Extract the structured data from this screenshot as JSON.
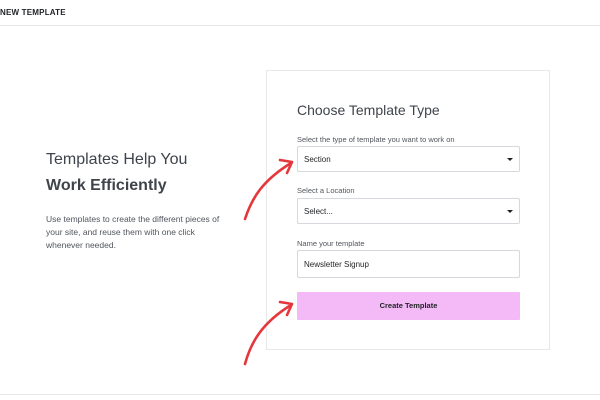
{
  "header": {
    "title": "NEW TEMPLATE"
  },
  "intro": {
    "title_line1": "Templates Help You",
    "title_line2": "Work Efficiently",
    "description": "Use templates to create the different pieces of your site, and reuse them with one click whenever needed."
  },
  "form": {
    "title": "Choose Template Type",
    "type_label": "Select the type of template you want to work on",
    "type_value": "Section",
    "location_label": "Select a Location",
    "location_value": "Select...",
    "name_label": "Name your template",
    "name_value": "Newsletter Signup",
    "submit_label": "Create Template"
  },
  "colors": {
    "button_bg": "#f4baf8",
    "arrow": "#e5373b"
  },
  "icons": [
    "chevron-down-icon",
    "red-arrow-annotation"
  ]
}
